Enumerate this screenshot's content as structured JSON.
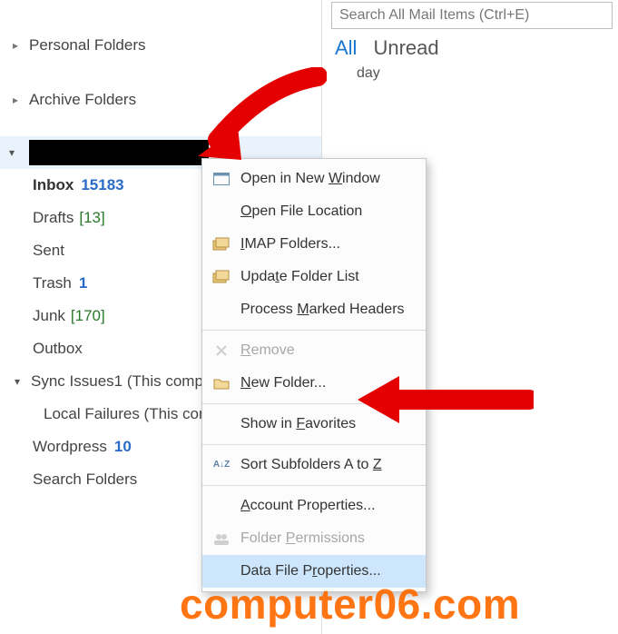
{
  "nav": {
    "favorites_collapsed": true,
    "personal_folders": "Personal Folders",
    "archive_folders": "Archive Folders",
    "account_redacted": true,
    "items": [
      {
        "label": "Inbox",
        "count_blue": "15183",
        "bold": true
      },
      {
        "label": "Drafts",
        "count_bracket": "[13]"
      },
      {
        "label": "Sent"
      },
      {
        "label": "Trash",
        "count_blue": "1"
      },
      {
        "label": "Junk",
        "count_bracket": "[170]"
      },
      {
        "label": "Outbox"
      },
      {
        "label": "Sync Issues1 (This compu",
        "expandable": true
      },
      {
        "label": "Local Failures (This com",
        "child": true
      },
      {
        "label": "Wordpress",
        "count_blue": "10"
      },
      {
        "label": "Search Folders"
      }
    ]
  },
  "right": {
    "search_placeholder": "Search All Mail Items (Ctrl+E)",
    "filter_all": "All",
    "filter_unread": "Unread",
    "day_header": "day"
  },
  "menu": {
    "items": [
      {
        "id": "open-new-window",
        "label_pre": "Open in New ",
        "mn": "W",
        "label_post": "indow",
        "icon": "window"
      },
      {
        "id": "open-file-location",
        "label_pre": "",
        "mn": "O",
        "label_post": "pen File Location"
      },
      {
        "id": "imap-folders",
        "label_pre": "",
        "mn": "I",
        "label_post": "MAP Folders...",
        "icon": "folders"
      },
      {
        "id": "update-folder-list",
        "label_pre": "Upda",
        "mn": "t",
        "label_post": "e Folder List",
        "icon": "folders2"
      },
      {
        "id": "process-marked-headers",
        "label_pre": "Process ",
        "mn": "M",
        "label_post": "arked Headers"
      },
      {
        "sep": true
      },
      {
        "id": "remove",
        "label_pre": "",
        "mn": "R",
        "label_post": "emove",
        "disabled": true
      },
      {
        "id": "new-folder",
        "label_pre": "",
        "mn": "N",
        "label_post": "ew Folder...",
        "icon": "folder"
      },
      {
        "sep": true
      },
      {
        "id": "show-in-favorites",
        "label_pre": "Show in ",
        "mn": "F",
        "label_post": "avorites"
      },
      {
        "sep": true
      },
      {
        "id": "sort-subfolders",
        "label_pre": "Sort Subfolders A to ",
        "mn": "Z",
        "label_post": "",
        "icon": "az"
      },
      {
        "sep": true
      },
      {
        "id": "account-properties",
        "label_pre": "",
        "mn": "A",
        "label_post": "ccount Properties..."
      },
      {
        "id": "folder-permissions",
        "label_pre": "Folder ",
        "mn": "P",
        "label_post": "ermissions",
        "icon": "people",
        "disabled": true
      },
      {
        "id": "data-file-properties",
        "label_pre": "Data File P",
        "mn": "r",
        "label_post": "operties...",
        "highlight": true
      }
    ]
  },
  "watermark": "computer06.com"
}
